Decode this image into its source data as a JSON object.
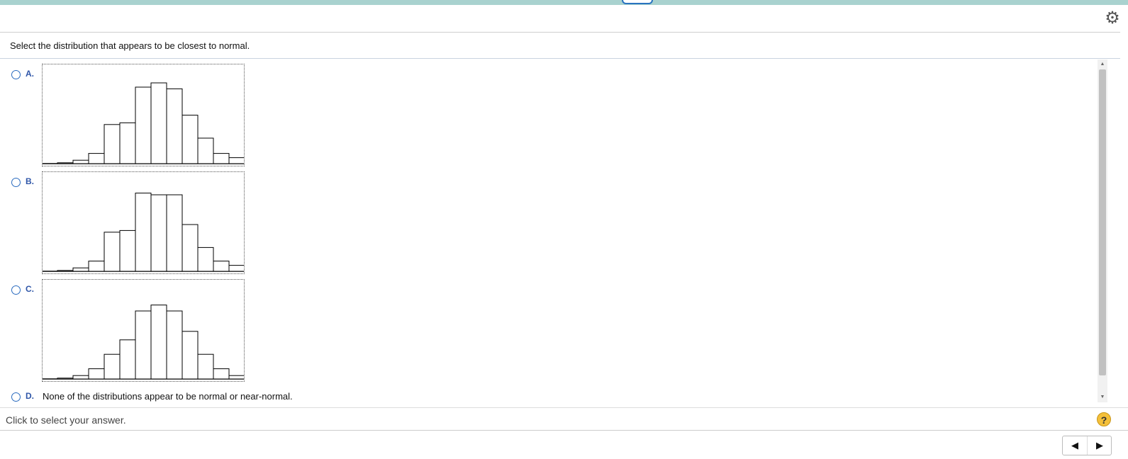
{
  "question": "Select the distribution that appears to be closest to normal.",
  "options": [
    {
      "letter": "A.",
      "hist_data": {
        "type": "bar",
        "values": [
          1,
          4,
          12,
          46,
          48,
          90,
          95,
          88,
          57,
          30,
          12,
          7
        ]
      }
    },
    {
      "letter": "B.",
      "hist_data": {
        "type": "bar",
        "values": [
          1,
          4,
          12,
          46,
          48,
          92,
          90,
          90,
          55,
          28,
          12,
          7
        ]
      }
    },
    {
      "letter": "C.",
      "hist_data": {
        "type": "bar",
        "values": [
          1,
          4,
          12,
          29,
          46,
          80,
          87,
          80,
          56,
          29,
          12,
          4
        ]
      }
    },
    {
      "letter": "D.",
      "text": "None of the distributions appear to be normal or near-normal."
    }
  ],
  "status_text": "Click to select your answer.",
  "icons": {
    "settings": "gear-icon",
    "help": "help-icon",
    "prev": "prev-arrow-icon",
    "next": "next-arrow-icon"
  },
  "help_label": "?",
  "colors": {
    "topbar": "#a9d2cf",
    "radio": "#2a6bbf",
    "option_letter": "#2f56a8",
    "help": "#f4c03a"
  }
}
